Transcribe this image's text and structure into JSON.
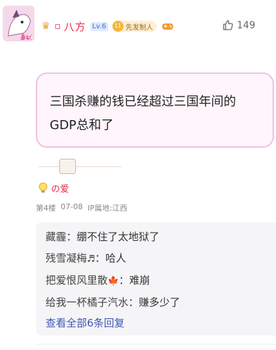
{
  "post": {
    "username": "八方",
    "level": "Lv.6",
    "badge_label": "先发制人",
    "badge_coin_text": "11",
    "like_count": "149",
    "quote_text": "三国杀赚的钱已经超过三国年间的GDP总和了",
    "signature_name": "の爱",
    "floor": "第4楼",
    "date": "07-08",
    "ip_location": "IP属地:江西"
  },
  "replies": [
    {
      "name": "藏霾",
      "emoji": "",
      "text": "绷不住了太地狱了"
    },
    {
      "name": "残雪凝梅",
      "emoji": "♬",
      "text": "哈人"
    },
    {
      "name": "把爱恨风里散",
      "emoji": "🍁",
      "text": "难崩"
    },
    {
      "name": "给我一杯橘子汽水",
      "emoji": "",
      "text": "赚多少了"
    }
  ],
  "view_all_label": "查看全部6条回复",
  "colors": {
    "username": "#e0304a",
    "link": "#3f57b6",
    "quote_border": "#ecc3e3",
    "quote_bg": "#fff5fb"
  },
  "icons": [
    "avatar",
    "crown-icon",
    "gamepad-icon",
    "thumbs-up-icon",
    "lightbulb-icon"
  ]
}
